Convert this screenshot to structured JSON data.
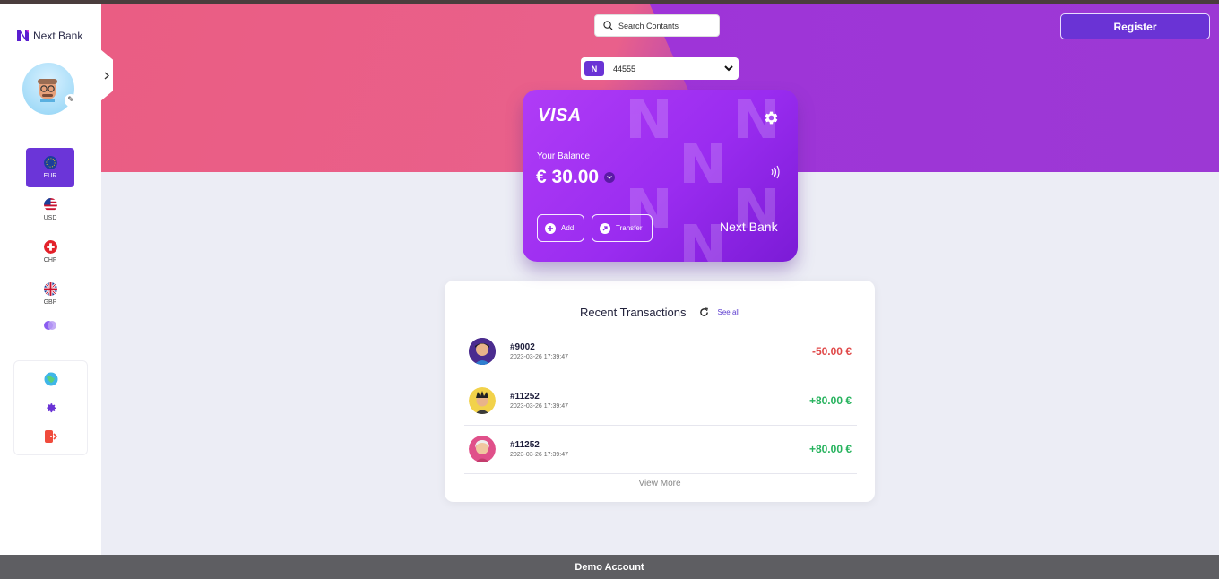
{
  "app": {
    "brand": "Next Bank"
  },
  "header": {
    "search_placeholder": "Search Contants",
    "register_label": "Register",
    "account_number": "44555",
    "account_logo": "N"
  },
  "sidebar": {
    "currencies": [
      {
        "code": "EUR",
        "active": true
      },
      {
        "code": "USD",
        "active": false
      },
      {
        "code": "CHF",
        "active": false
      },
      {
        "code": "GBP",
        "active": false
      }
    ]
  },
  "card": {
    "network": "VISA",
    "balance_label": "Your Balance",
    "balance": "€ 30.00",
    "add_label": "Add",
    "transfer_label": "Transfer",
    "bank_name": "Next Bank"
  },
  "transactions": {
    "title": "Recent Transactions",
    "see_all": "See all",
    "items": [
      {
        "id": "#9002",
        "date": "2023-03-26 17:39:47",
        "amount": "-50.00 €",
        "direction": "out"
      },
      {
        "id": "#11252",
        "date": "2023-03-26 17:39:47",
        "amount": "+80.00 €",
        "direction": "in"
      },
      {
        "id": "#11252",
        "date": "2023-03-26 17:39:47",
        "amount": "+80.00 €",
        "direction": "in"
      }
    ],
    "view_more": "View More"
  },
  "footer": {
    "label": "Demo Account"
  },
  "colors": {
    "accent": "#6a33d5",
    "negative": "#e04848",
    "positive": "#27b35e"
  }
}
